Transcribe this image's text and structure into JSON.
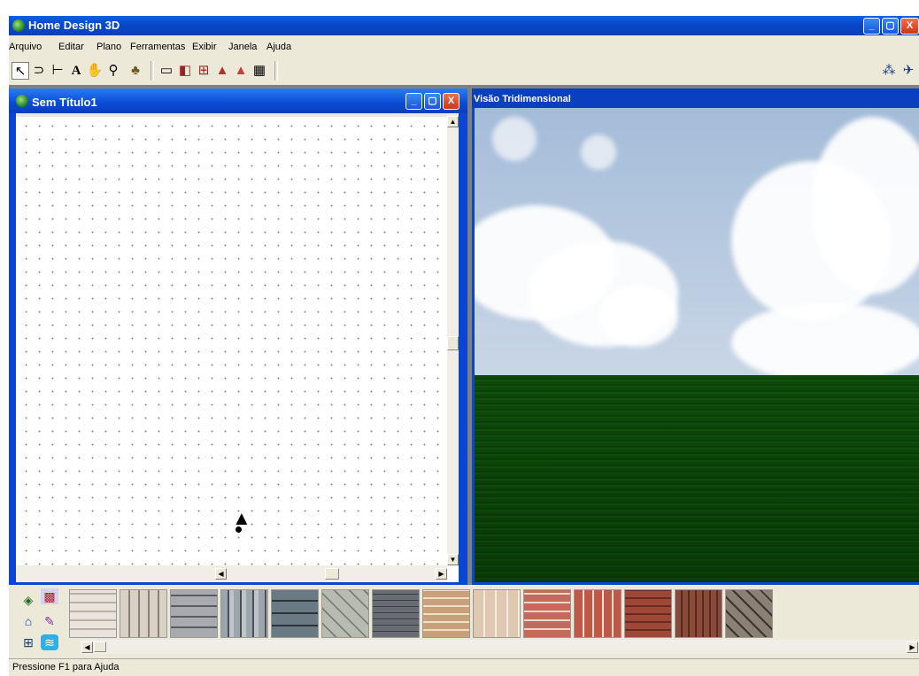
{
  "app": {
    "title": "Home Design 3D",
    "window_buttons": {
      "minimize": "_",
      "maximize": "▢",
      "close": "X"
    }
  },
  "menu": {
    "items": [
      "Arquivo",
      "Editar",
      "Plano",
      "Ferramentas",
      "Exibir",
      "Janela",
      "Ajuda"
    ]
  },
  "toolbar": {
    "tools": [
      {
        "name": "select-arrow-icon",
        "glyph": "↖",
        "selected": true
      },
      {
        "name": "lasso-icon",
        "glyph": "⊃"
      },
      {
        "name": "dimension-icon",
        "glyph": "⊢"
      },
      {
        "name": "text-icon",
        "glyph": "A"
      },
      {
        "name": "hand-pan-icon",
        "glyph": "✋"
      },
      {
        "name": "zoom-icon",
        "glyph": "⚲"
      },
      {
        "name": "paint-icon",
        "glyph": "♣"
      },
      {
        "name": "wall-icon",
        "glyph": "▭"
      },
      {
        "name": "door-icon",
        "glyph": "◧"
      },
      {
        "name": "window-icon",
        "glyph": "⊞"
      },
      {
        "name": "roof-icon",
        "glyph": "▲"
      },
      {
        "name": "roof-red-icon",
        "glyph": "▲"
      },
      {
        "name": "floor-grid-icon",
        "glyph": "▦"
      }
    ],
    "right_tools": [
      {
        "name": "walk-icon",
        "glyph": "⁂"
      },
      {
        "name": "helicopter-icon",
        "glyph": "✈"
      }
    ]
  },
  "plan_window": {
    "title": "Sem Título1",
    "marker_glyph": "▲"
  },
  "view3d": {
    "title": "Visão Tridimensional"
  },
  "palette": {
    "left_icons": [
      {
        "name": "object-icon",
        "glyph": "◈"
      },
      {
        "name": "texture-icon",
        "glyph": "▩"
      },
      {
        "name": "house-icon",
        "glyph": "⌂"
      },
      {
        "name": "paint-brush-icon",
        "glyph": "✎"
      },
      {
        "name": "floorplan-icon",
        "glyph": "⊞"
      },
      {
        "name": "water-icon",
        "glyph": "≋"
      }
    ],
    "textures": [
      "stone-white",
      "stone-rough",
      "stone-grey",
      "stone-slate",
      "stone-blocks",
      "stone-tiles",
      "brick-grey",
      "brick-tan",
      "brick-pale",
      "brick-red",
      "brick-vertical",
      "brick-dark",
      "brick-brown",
      "brick-herringbone"
    ],
    "scroll_left": "◀",
    "scroll_right": "▶"
  },
  "status": {
    "text": "Pressione F1 para Ajuda"
  },
  "colors": {
    "titlebar": "#0a4ad6",
    "menu_bg": "#ece9d8",
    "close": "#c83818"
  }
}
